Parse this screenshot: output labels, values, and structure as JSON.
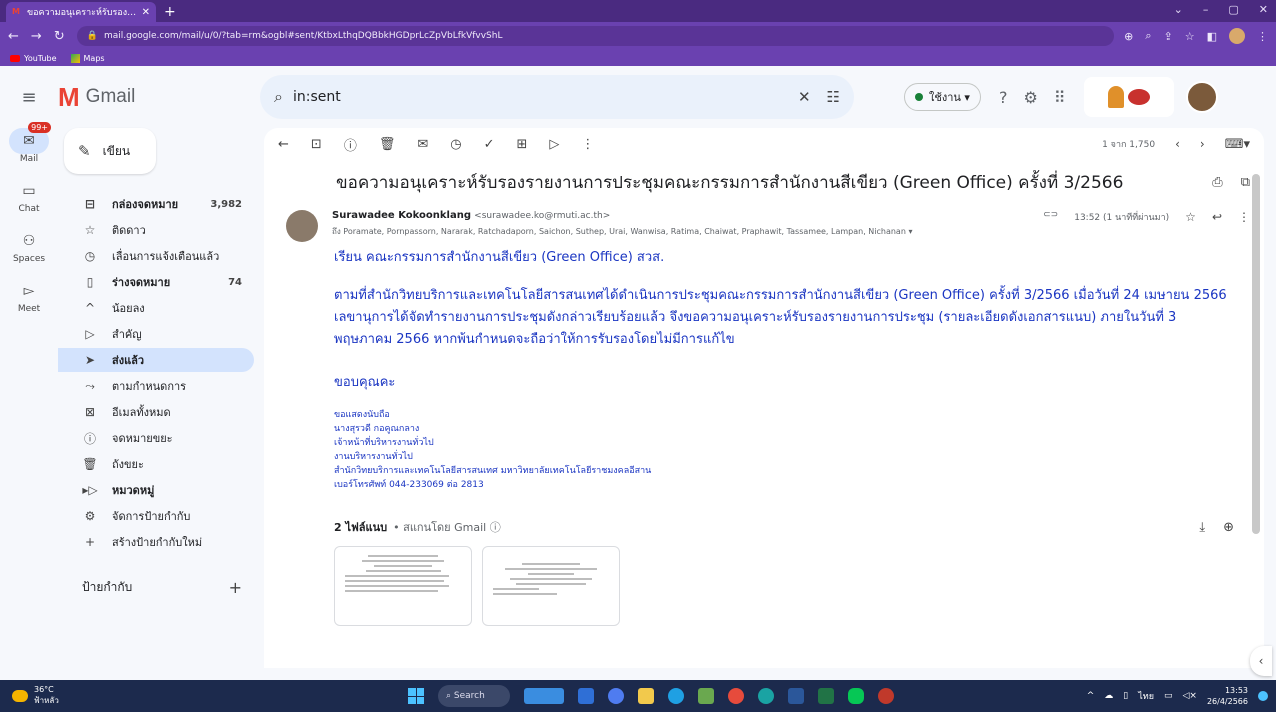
{
  "browser": {
    "tab_title": "ขอความอนุเคราะห์รับรองรายงานการประชุม",
    "new_tab": "+",
    "url": "mail.google.com/mail/u/0/?tab=rm&ogbl#sent/KtbxLthqDQBbkHGDprLcZpVbLfkVfvvShL",
    "bookmarks": [
      {
        "label": "YouTube"
      },
      {
        "label": "Maps"
      }
    ]
  },
  "gmail": {
    "product_name": "Gmail",
    "search_value": "in:sent",
    "status_label": "ใช้งาน"
  },
  "rail": {
    "mail_badge": "99+",
    "items": [
      {
        "label": "Mail"
      },
      {
        "label": "Chat"
      },
      {
        "label": "Spaces"
      },
      {
        "label": "Meet"
      }
    ]
  },
  "sidebar": {
    "compose_label": "เขียน",
    "items": [
      {
        "label": "กล่องจดหมาย",
        "count": "3,982"
      },
      {
        "label": "ติดดาว",
        "count": ""
      },
      {
        "label": "เลื่อนการแจ้งเตือนแล้ว",
        "count": ""
      },
      {
        "label": "ร่างจดหมาย",
        "count": "74"
      },
      {
        "label": "น้อยลง",
        "count": ""
      },
      {
        "label": "สำคัญ",
        "count": ""
      },
      {
        "label": "ส่งแล้ว",
        "count": ""
      },
      {
        "label": "ตามกำหนดการ",
        "count": ""
      },
      {
        "label": "อีเมลทั้งหมด",
        "count": ""
      },
      {
        "label": "จดหมายขยะ",
        "count": ""
      },
      {
        "label": "ถังขยะ",
        "count": ""
      },
      {
        "label": "หมวดหมู่",
        "count": ""
      },
      {
        "label": "จัดการป้ายกำกับ",
        "count": ""
      },
      {
        "label": "สร้างป้ายกำกับใหม่",
        "count": ""
      }
    ],
    "labels_heading": "ป้ายกำกับ"
  },
  "message": {
    "pagination": "1 จาก 1,750",
    "subject": "ขอความอนุเคราะห์รับรองรายงานการประชุมคณะกรรมการสำนักงานสีเขียว (Green Office) ครั้งที่ 3/2566",
    "sender_name": "Surawadee Kokoonklang",
    "sender_email": "<surawadee.ko@rmuti.ac.th>",
    "to_line": "ถึง Poramate, Pornpassorn, Nararak, Ratchadaporn, Saichon, Suthep, Urai, Wanwisa, Ratima, Chaiwat, Praphawit, Tassamee, Lampan, Nichanan ▾",
    "time": "13:52 (1 นาทีที่ผ่านมา)",
    "greeting": "เรียน คณะกรรมการสำนักงานสีเขียว (Green Office) สวส.",
    "paragraph": "ตามที่สำนักวิทยบริการและเทคโนโลยีสารสนเทศได้ดำเนินการประชุมคณะกรรมการสำนักงานสีเขียว (Green Office) ครั้งที่ 3/2566 เมื่อวันที่ 24 เมษายน 2566 เลขานุการได้จัดทำรายงานการประชุมดังกล่าวเรียบร้อยแล้ว จึงขอความอนุเคราะห์รับรองรายงานการประชุม (รายละเอียดดังเอกสารแนบ) ภายในวันที่ 3 พฤษภาคม 2566 หากพ้นกำหนดจะถือว่าให้การรับรองโดยไม่มีการแก้ไข",
    "thanks": "ขอบคุณคะ",
    "signature": [
      "ขอแสดงนับถือ",
      "นางสุรวดี  กอคูณกลาง",
      "เจ้าหน้าที่บริหารงานทั่วไป",
      "งานบริหารงานทั่วไป",
      "สำนักวิทยบริการและเทคโนโลยีสารสนเทศ มหาวิทยาลัยเทคโนโลยีราชมงคลอีสาน",
      "เบอร์โทรศัพท์ 044-233069 ต่อ 2813"
    ],
    "attachments_count": "2 ไฟล์แนบ",
    "attachments_scan": "• สแกนโดย Gmail ⓘ"
  },
  "taskbar": {
    "weather_temp": "36°C",
    "weather_desc": "ฟ้าหลัว",
    "search_label": "Search",
    "lang": "ไทย",
    "time": "13:53",
    "date": "26/4/2566"
  },
  "colors": {
    "chrome": "#6a41b0",
    "body_text": "#1a35c2",
    "active_nav": "#d3e3fd"
  }
}
